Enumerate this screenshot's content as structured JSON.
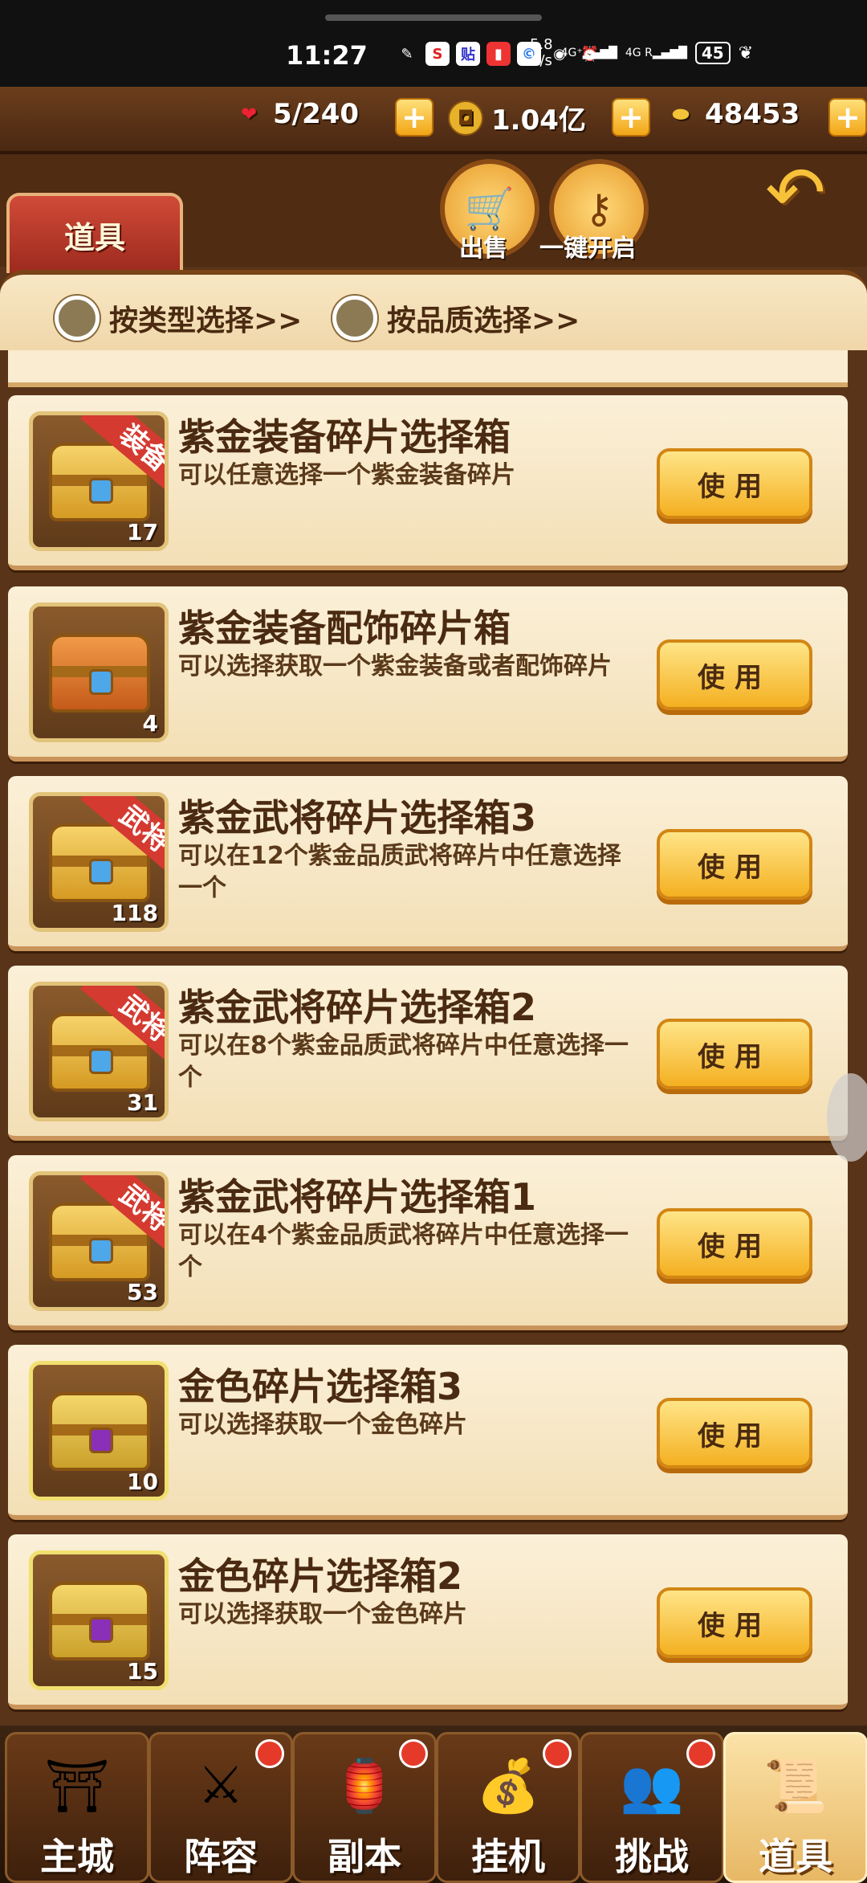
{
  "status": {
    "time": "11:27",
    "speed_top": "5.8",
    "speed_bottom": "K/s",
    "net1": "4G⁺",
    "net2": "4G R",
    "battery": "45"
  },
  "resources": {
    "stamina": "5/240",
    "coins": "1.04亿",
    "ingots": "48453"
  },
  "tab": {
    "label": "道具"
  },
  "actions": {
    "sell": "出售",
    "open_all": "一键开启"
  },
  "filters": {
    "by_type": "按类型选择>>",
    "by_quality": "按品质选择>>"
  },
  "items": [
    {
      "title": "紫金装备碎片选择箱",
      "desc": "可以任意选择一个紫金装备碎片",
      "count": "17",
      "ribbon": "装备",
      "chest": "gold",
      "button": "使用"
    },
    {
      "title": "紫金装备配饰碎片箱",
      "desc": "可以选择获取一个紫金装备或者配饰碎片",
      "count": "4",
      "ribbon": "",
      "chest": "orange",
      "button": "使用"
    },
    {
      "title": "紫金武将碎片选择箱3",
      "desc": "可以在12个紫金品质武将碎片中任意选择一个",
      "count": "118",
      "ribbon": "武将",
      "chest": "gold",
      "button": "使用"
    },
    {
      "title": "紫金武将碎片选择箱2",
      "desc": "可以在8个紫金品质武将碎片中任意选择一个",
      "count": "31",
      "ribbon": "武将",
      "chest": "gold",
      "button": "使用"
    },
    {
      "title": "紫金武将碎片选择箱1",
      "desc": "可以在4个紫金品质武将碎片中任意选择一个",
      "count": "53",
      "ribbon": "武将",
      "chest": "gold",
      "button": "使用"
    },
    {
      "title": "金色碎片选择箱3",
      "desc": "可以选择获取一个金色碎片",
      "count": "10",
      "ribbon": "",
      "chest": "purple",
      "button": "使用"
    },
    {
      "title": "金色碎片选择箱2",
      "desc": "可以选择获取一个金色碎片",
      "count": "15",
      "ribbon": "",
      "chest": "purple",
      "button": "使用"
    }
  ],
  "nav": [
    {
      "label": "主城",
      "icon": "city-gate-icon",
      "badge": false,
      "active": false
    },
    {
      "label": "阵容",
      "icon": "formation-icon",
      "badge": true,
      "active": false
    },
    {
      "label": "副本",
      "icon": "dungeon-icon",
      "badge": true,
      "active": false
    },
    {
      "label": "挂机",
      "icon": "idle-icon",
      "badge": true,
      "active": false
    },
    {
      "label": "挑战",
      "icon": "challenge-icon",
      "badge": true,
      "active": false
    },
    {
      "label": "道具",
      "icon": "items-bag-icon",
      "badge": false,
      "active": true
    }
  ],
  "colors": {
    "accent": "#f4b021",
    "tab_red": "#c53a2a",
    "card_bg": "#fbf0d8",
    "text_brown": "#4a2a10"
  }
}
